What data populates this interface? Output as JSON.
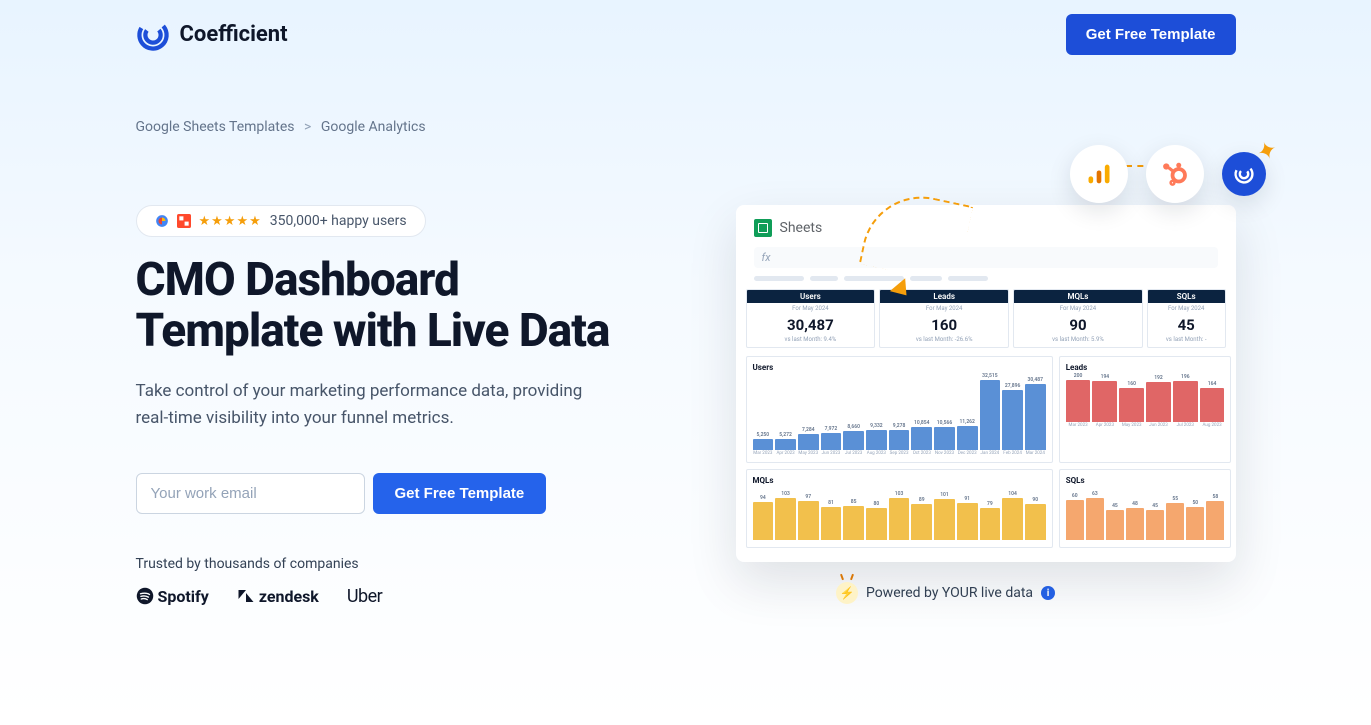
{
  "header": {
    "brand": "Coefficient",
    "cta": "Get Free Template"
  },
  "breadcrumb": {
    "parent": "Google Sheets Templates",
    "sep": ">",
    "current": "Google Analytics"
  },
  "social": {
    "stars": "★★★★★",
    "text": "350,000+ happy users"
  },
  "hero": {
    "title": "CMO Dashboard Template with Live Data",
    "subtitle": "Take control of your marketing performance data, providing real-time visibility into your funnel metrics.",
    "email_placeholder": "Your work email",
    "form_cta": "Get Free Template",
    "trusted_label": "Trusted by thousands of companies",
    "companies": {
      "spotify": "Spotify",
      "zendesk": "zendesk",
      "uber": "Uber"
    }
  },
  "dashboard": {
    "app_label": "Sheets",
    "fx": "fx",
    "kpis": [
      {
        "label": "Users",
        "period": "For May 2024",
        "value": "30,487",
        "delta": "vs last Month: 9.4%"
      },
      {
        "label": "Leads",
        "period": "For May 2024",
        "value": "160",
        "delta": "vs last Month: -26.6%"
      },
      {
        "label": "MQLs",
        "period": "For May 2024",
        "value": "90",
        "delta": "vs last Month: 5.9%"
      },
      {
        "label": "SQLs",
        "period": "For May 2024",
        "value": "45",
        "delta": "vs last Month: -"
      }
    ],
    "powered": "Powered by YOUR live data",
    "info": "i"
  },
  "chart_data": [
    {
      "type": "bar",
      "title": "Users",
      "color": "blue",
      "categories": [
        "Mar 2023",
        "Apr 2023",
        "May 2023",
        "Jun 2023",
        "Jul 2023",
        "Aug 2023",
        "Sep 2023",
        "Oct 2023",
        "Nov 2023",
        "Dec 2023",
        "Jan 2024",
        "Feb 2024",
        "Mar 2024"
      ],
      "values": [
        5250,
        5272,
        7284,
        7972,
        8660,
        9332,
        9278,
        10854,
        10566,
        11262,
        32515,
        27896,
        30487
      ]
    },
    {
      "type": "bar",
      "title": "Leads",
      "color": "red",
      "categories": [
        "Mar 2023",
        "Apr 2023",
        "May 2023",
        "Jun 2023",
        "Jul 2023",
        "Aug 2023"
      ],
      "values": [
        200,
        194,
        160,
        192,
        196,
        164
      ]
    },
    {
      "type": "bar",
      "title": "MQLs",
      "color": "yellow",
      "categories": [
        "",
        "",
        "",
        "",
        "",
        "",
        "",
        "",
        "",
        "",
        "",
        "",
        ""
      ],
      "values": [
        94,
        103,
        97,
        81,
        85,
        80,
        103,
        89,
        101,
        91,
        79,
        104,
        90
      ]
    },
    {
      "type": "bar",
      "title": "SQLs",
      "color": "orange",
      "categories": [
        "",
        "",
        "",
        "",
        "",
        "",
        "",
        ""
      ],
      "values": [
        60,
        63,
        45,
        48,
        45,
        55,
        50,
        58
      ]
    }
  ]
}
